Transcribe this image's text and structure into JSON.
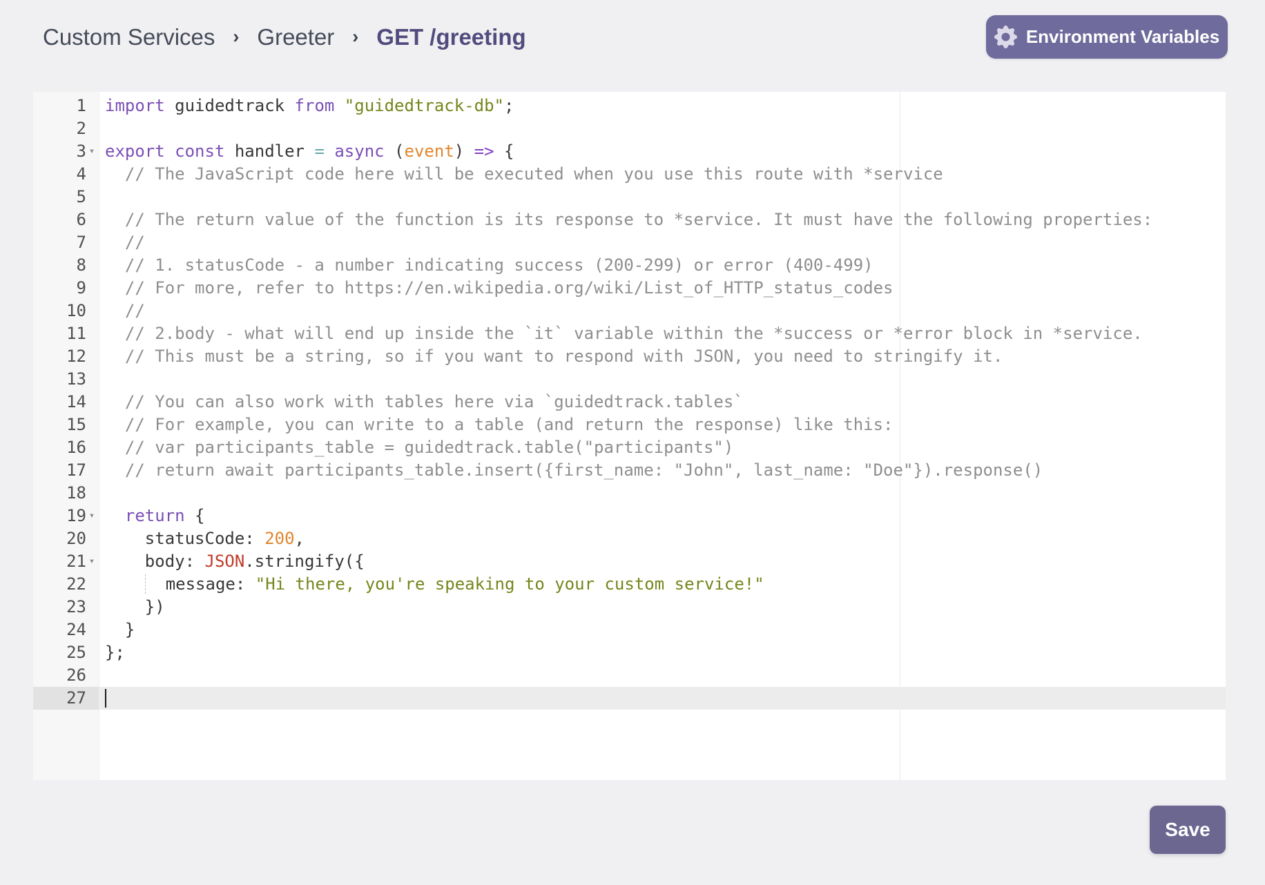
{
  "colors": {
    "page_bg": "#f0f0f2",
    "accent_purple": "#6f6b9c",
    "save_purple": "#6b6791",
    "breadcrumb_current": "#514c7d",
    "active_line_bg": "#ececec"
  },
  "breadcrumb": {
    "separator": "›",
    "items": [
      {
        "label": "Custom Services"
      },
      {
        "label": "Greeter"
      },
      {
        "label": "GET /greeting"
      }
    ]
  },
  "header": {
    "env_button": {
      "label": "Environment Variables",
      "icon": "gear"
    }
  },
  "footer": {
    "save_label": "Save"
  },
  "editor": {
    "fold_icon": "▾",
    "ruler_col": 80,
    "active_line": 27,
    "lines": [
      {
        "n": 1,
        "seg": [
          [
            "kw",
            "import"
          ],
          [
            "pl",
            " guidedtrack "
          ],
          [
            "kw",
            "from"
          ],
          [
            "pl",
            " "
          ],
          [
            "str",
            "\"guidedtrack-db\""
          ],
          [
            "pl",
            ";"
          ]
        ]
      },
      {
        "n": 2,
        "seg": []
      },
      {
        "n": 3,
        "fold": true,
        "seg": [
          [
            "kw",
            "export"
          ],
          [
            "pl",
            " "
          ],
          [
            "kw",
            "const"
          ],
          [
            "pl",
            " handler "
          ],
          [
            "op",
            "="
          ],
          [
            "pl",
            " "
          ],
          [
            "kw",
            "async"
          ],
          [
            "pl",
            " ("
          ],
          [
            "num",
            "event"
          ],
          [
            "pl",
            ") "
          ],
          [
            "arrow",
            "=>"
          ],
          [
            "pl",
            " {"
          ]
        ]
      },
      {
        "n": 4,
        "seg": [
          [
            "cm",
            "  // The JavaScript code here will be executed when you use this route with *service"
          ]
        ]
      },
      {
        "n": 5,
        "seg": []
      },
      {
        "n": 6,
        "seg": [
          [
            "cm",
            "  // The return value of the function is its response to *service. It must have the following properties:"
          ]
        ]
      },
      {
        "n": 7,
        "seg": [
          [
            "cm",
            "  //"
          ]
        ]
      },
      {
        "n": 8,
        "seg": [
          [
            "cm",
            "  // 1. statusCode - a number indicating success (200-299) or error (400-499)"
          ]
        ]
      },
      {
        "n": 9,
        "seg": [
          [
            "cm",
            "  // For more, refer to https://en.wikipedia.org/wiki/List_of_HTTP_status_codes"
          ]
        ]
      },
      {
        "n": 10,
        "seg": [
          [
            "cm",
            "  //"
          ]
        ]
      },
      {
        "n": 11,
        "seg": [
          [
            "cm",
            "  // 2.body - what will end up inside the `it` variable within the *success or *error block in *service."
          ]
        ]
      },
      {
        "n": 12,
        "seg": [
          [
            "cm",
            "  // This must be a string, so if you want to respond with JSON, you need to stringify it."
          ]
        ]
      },
      {
        "n": 13,
        "seg": []
      },
      {
        "n": 14,
        "seg": [
          [
            "cm",
            "  // You can also work with tables here via `guidedtrack.tables`"
          ]
        ]
      },
      {
        "n": 15,
        "seg": [
          [
            "cm",
            "  // For example, you can write to a table (and return the response) like this:"
          ]
        ]
      },
      {
        "n": 16,
        "seg": [
          [
            "cm",
            "  // var participants_table = guidedtrack.table(\"participants\")"
          ]
        ]
      },
      {
        "n": 17,
        "seg": [
          [
            "cm",
            "  // return await participants_table.insert({first_name: \"John\", last_name: \"Doe\"}).response()"
          ]
        ]
      },
      {
        "n": 18,
        "seg": []
      },
      {
        "n": 19,
        "fold": true,
        "seg": [
          [
            "pl",
            "  "
          ],
          [
            "kw",
            "return"
          ],
          [
            "pl",
            " {"
          ]
        ]
      },
      {
        "n": 20,
        "seg": [
          [
            "pl",
            "    statusCode: "
          ],
          [
            "num",
            "200"
          ],
          [
            "pl",
            ","
          ]
        ]
      },
      {
        "n": 21,
        "fold": true,
        "seg": [
          [
            "pl",
            "    body: "
          ],
          [
            "err",
            "JSON"
          ],
          [
            "pl",
            ".stringify({"
          ]
        ]
      },
      {
        "n": 22,
        "seg": [
          [
            "pl",
            "    "
          ],
          [
            "guide",
            "  "
          ],
          [
            "pl",
            "message: "
          ],
          [
            "str",
            "\"Hi there, you're speaking to your custom service!\""
          ]
        ]
      },
      {
        "n": 23,
        "seg": [
          [
            "pl",
            "    })"
          ]
        ]
      },
      {
        "n": 24,
        "seg": [
          [
            "pl",
            "  }"
          ]
        ]
      },
      {
        "n": 25,
        "seg": [
          [
            "pl",
            "};"
          ]
        ]
      },
      {
        "n": 26,
        "seg": []
      },
      {
        "n": 27,
        "active": true,
        "cursor": true,
        "seg": []
      }
    ]
  }
}
